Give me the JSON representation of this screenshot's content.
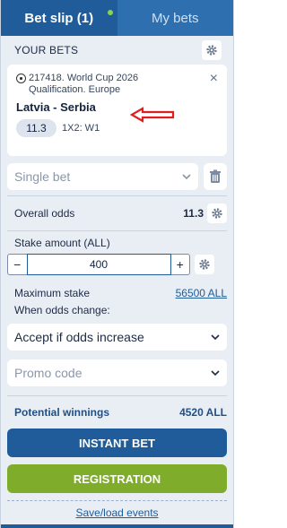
{
  "tabs": [
    {
      "label": "Bet slip (1)"
    },
    {
      "label": "My bets"
    }
  ],
  "your_bets": {
    "title": "YOUR BETS"
  },
  "event": {
    "header": "217418. World Cup 2026 Qualification. Europe",
    "teams": "Latvia - Serbia",
    "odds": "11.3",
    "bet_type": "1X2: W1"
  },
  "bet_mode": {
    "selected": "Single bet"
  },
  "overall_odds": {
    "label": "Overall odds",
    "value": "11.3"
  },
  "stake": {
    "label": "Stake amount (ALL)",
    "value": "400",
    "minus": "−",
    "plus": "+"
  },
  "max_stake": {
    "label": "Maximum stake",
    "value": "56500 ALL"
  },
  "odds_change": {
    "label": "When odds change:",
    "selected": "Accept if odds increase"
  },
  "promo": {
    "placeholder": "Promo code"
  },
  "winnings": {
    "label": "Potential winnings",
    "value": "4520 ALL"
  },
  "buttons": {
    "instant_bet": "INSTANT BET",
    "registration": "REGISTRATION"
  },
  "save_load": "Save/load events",
  "colors": {
    "primary": "#1f5c99",
    "green": "#7fac2a",
    "accent_dot": "#8bd34b",
    "arrow": "#e01e1e"
  }
}
